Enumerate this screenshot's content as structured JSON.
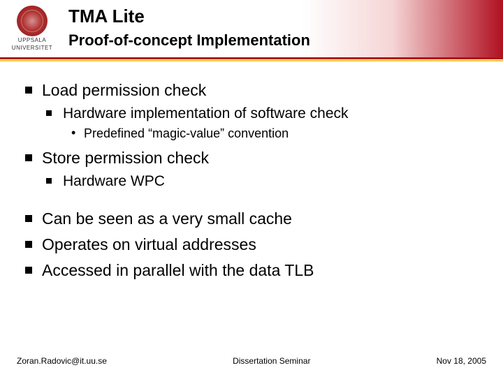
{
  "header": {
    "logo_line1": "UPPSALA",
    "logo_line2": "UNIVERSITET",
    "title": "TMA Lite",
    "subtitle": "Proof-of-concept Implementation"
  },
  "bullets": {
    "b1": "Load permission check",
    "b1_1": "Hardware implementation of software check",
    "b1_1_1": "Predefined “magic-value” convention",
    "b2": "Store permission check",
    "b2_1": "Hardware WPC",
    "b3": "Can be seen as a very small cache",
    "b4": "Operates on virtual addresses",
    "b5": "Accessed in parallel with the data TLB"
  },
  "footer": {
    "left": "Zoran.Radovic@it.uu.se",
    "center": "Dissertation Seminar",
    "right": "Nov 18, 2005"
  }
}
